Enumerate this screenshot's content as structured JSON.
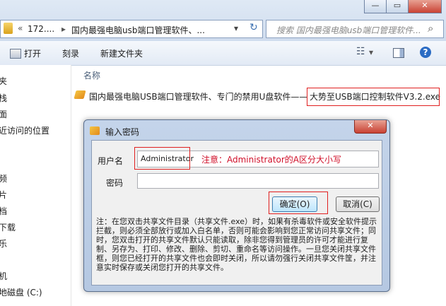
{
  "window": {
    "min_glyph": "—",
    "max_glyph": "▭",
    "close_glyph": "✕"
  },
  "addressbar": {
    "back_glyph": "«",
    "path_part1": "172....",
    "sep": "▸",
    "path_part2": "国内最强电脑usb端口管理软件、...",
    "dropdown_glyph": "▾",
    "refresh_glyph": "↻",
    "search_placeholder": "搜索 国内最强电脑usb端口管理软件...",
    "search_glyph": "⌕"
  },
  "toolbar": {
    "open_label": "打开",
    "burn_label": "刻录",
    "new_folder_label": "新建文件夹",
    "view_glyph": "☷",
    "view_arrow": "▾",
    "help_glyph": "?"
  },
  "nav": {
    "items": [
      "夹",
      "栈",
      "面",
      "近访问的位置",
      "频",
      "片",
      "档",
      "下载",
      "乐",
      "机",
      "地磁盘 (C:)",
      "..."
    ]
  },
  "content": {
    "column_name": "名称",
    "file_name_left": "国内最强电脑USB端口管理软件、专门的禁用U盘软件——",
    "file_name_right": "大势至USB端口控制软件V3.2.exe"
  },
  "dialog": {
    "title": "输入密码",
    "close_glyph": "✕",
    "username_label": "用户名",
    "username_value": "Administrator",
    "username_hint": "注意：Administrator的A区分大小写",
    "password_label": "密码",
    "password_value": "",
    "ok_label": "确定(O)",
    "cancel_label": "取消(C)",
    "note": "注：在您双击共享文件目录（共享文件.exe）时，如果有杀毒软件或安全软件提示拦截，则必须全部放行或加入白名单，否则可能会影响到您正常访问共享文件；同时，您双击打开的共享文件默认只能读取，除非您得到管理员的许可才能进行复制、另存为、打印、修改、删除、剪切、重命名等访问操作。一旦您关闭共享文件框，则您已经打开的共享文件也会即时关闭，所以请勿强行关闭共享文件筐，并注意实时保存或关闭您打开的共享文件。"
  },
  "colors": {
    "annotation_red": "#e02020",
    "hint_red": "#d0102a",
    "close_red": "#c94234"
  }
}
